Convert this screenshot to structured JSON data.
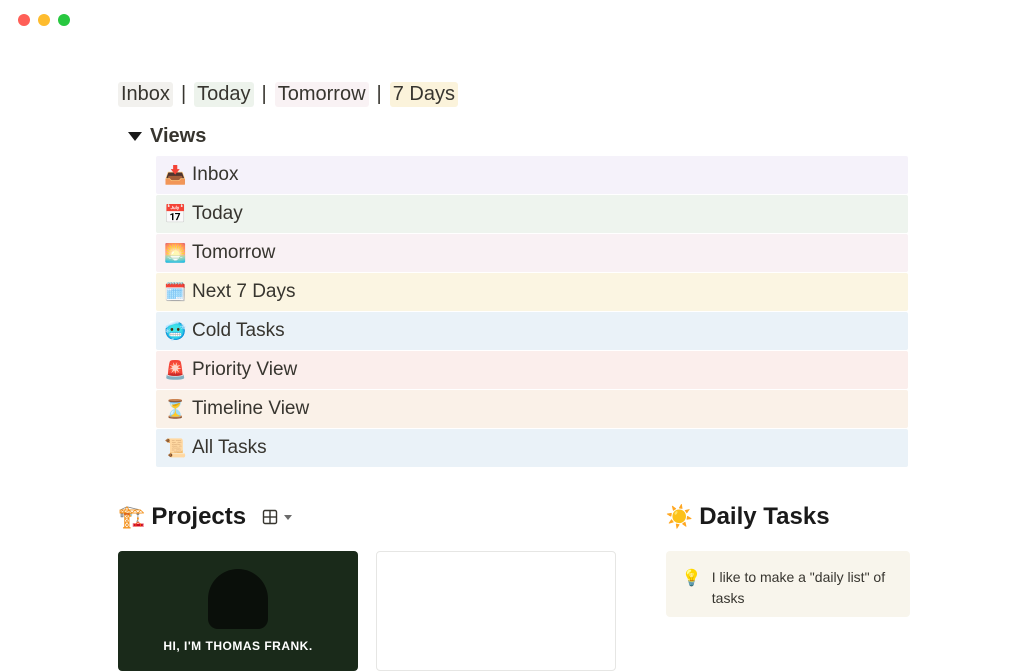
{
  "nav": {
    "links": [
      {
        "label": "Inbox",
        "cls": "inbox"
      },
      {
        "label": "Today",
        "cls": "today"
      },
      {
        "label": "Tomorrow",
        "cls": "tomorrow"
      },
      {
        "label": "7 Days",
        "cls": "sevendays"
      }
    ],
    "separator": "|"
  },
  "views": {
    "title": "Views",
    "items": [
      {
        "emoji": "📥",
        "label": "Inbox",
        "bg": "bg-lav"
      },
      {
        "emoji": "📅",
        "label": "Today",
        "bg": "bg-grn"
      },
      {
        "emoji": "🌅",
        "label": "Tomorrow",
        "bg": "bg-pnk"
      },
      {
        "emoji": "🗓️",
        "label": "Next 7 Days",
        "bg": "bg-yel"
      },
      {
        "emoji": "🥶",
        "label": "Cold Tasks",
        "bg": "bg-blu"
      },
      {
        "emoji": "🚨",
        "label": "Priority View",
        "bg": "bg-red"
      },
      {
        "emoji": "⏳",
        "label": "Timeline View",
        "bg": "bg-org"
      },
      {
        "emoji": "📜",
        "label": "All Tasks",
        "bg": "bg-blu"
      }
    ]
  },
  "projects": {
    "emoji": "🏗️",
    "title": "Projects",
    "card_caption": "HI, I'M THOMAS FRANK."
  },
  "daily": {
    "emoji": "☀️",
    "title": "Daily Tasks",
    "callout_emoji": "💡",
    "callout_text": "I like to make a \"daily list\" of tasks"
  }
}
